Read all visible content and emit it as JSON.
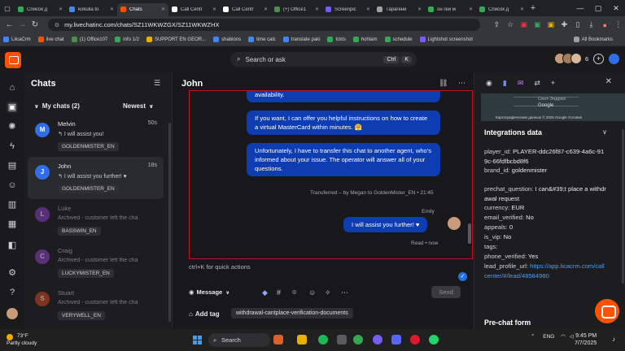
{
  "browser": {
    "tabs": [
      {
        "title": "Список д",
        "active": false,
        "color": "#34a853"
      },
      {
        "title": "kokulla to",
        "active": false,
        "color": "#4285f4"
      },
      {
        "title": "Chats",
        "active": true,
        "color": "#ff5100"
      },
      {
        "title": "Call Centr",
        "active": false,
        "color": "#ffffff"
      },
      {
        "title": "Call Centr",
        "active": false,
        "color": "#ffffff"
      },
      {
        "title": "(+) Office1",
        "active": false,
        "color": "#4a8f4a"
      },
      {
        "title": "Screenpic",
        "active": false,
        "color": "#7a5af8"
      },
      {
        "title": "Тарагени",
        "active": false,
        "color": "#a0a0a0"
      },
      {
        "title": "он гей м",
        "active": false,
        "color": "#34a853"
      },
      {
        "title": "Список д",
        "active": false,
        "color": "#34a853"
      }
    ],
    "new_tab": "+",
    "url": "my.livechatinc.com/chats/SZ11WKWZGX/SZ11WKWZHX",
    "bookmarks": [
      {
        "label": "LiicaCrm",
        "color": "#4285f4"
      },
      {
        "label": "live chat",
        "color": "#ff5100"
      },
      {
        "label": "(1) Office107",
        "color": "#4a8f4a"
      },
      {
        "label": "info 1/2",
        "color": "#34a853"
      },
      {
        "label": "SUPPORT EN GEOR...",
        "color": "#e8b100"
      },
      {
        "label": "shablons",
        "color": "#4285f4"
      },
      {
        "label": "time calc",
        "color": "#4285f4"
      },
      {
        "label": "translate paki",
        "color": "#4285f4"
      },
      {
        "label": "tckts",
        "color": "#34a853"
      },
      {
        "label": "hohlam",
        "color": "#34a853"
      },
      {
        "label": "schedule",
        "color": "#34a853"
      },
      {
        "label": "Lightshot screenshot",
        "color": "#7a5af8"
      }
    ],
    "all_bookmarks": "All Bookmarks"
  },
  "topbar": {
    "search_label": "Search or ask",
    "kbd_ctrl": "Ctrl",
    "kbd_k": "K",
    "agent_count": "6"
  },
  "chatlist": {
    "title": "Chats",
    "section": "My chats (2)",
    "sort": "Newest",
    "items": [
      {
        "initial": "M",
        "name": "Melvin",
        "time": "50s",
        "message": "I will assist you!",
        "tag": "GOLDENMISTER_EN",
        "avatar_color": "#2f6ee8",
        "active": false,
        "dim": false
      },
      {
        "initial": "J",
        "name": "John",
        "time": "18s",
        "message": "I will assist you further! ♥",
        "tag": "GOLDENMISTER_EN",
        "avatar_color": "#2f6ee8",
        "active": true,
        "dim": false
      },
      {
        "initial": "L",
        "name": "Luke",
        "time": "",
        "message": "Archived - customer left the cha",
        "tag": "BASSWIN_EN",
        "avatar_color": "#8a3fc4",
        "active": false,
        "dim": true
      },
      {
        "initial": "C",
        "name": "Craig",
        "time": "",
        "message": "Archived - customer left the cha",
        "tag": "LUCKYMISTER_EN",
        "avatar_color": "#8a3fc4",
        "active": false,
        "dim": true
      },
      {
        "initial": "S",
        "name": "Stuart",
        "time": "",
        "message": "Archived - customer left the cha",
        "tag": "VERYWELL_EN",
        "avatar_color": "#d1461e",
        "active": false,
        "dim": true
      }
    ]
  },
  "chat": {
    "title": "John",
    "messages": [
      {
        "text": "availability."
      },
      {
        "text": "If you want, I can offer you helpful instructions on how to create a virtual MasterCard within minutes. 🤗"
      },
      {
        "text": "Unfortunately, I have to transfer this chat to another agent, who's informed about your issue. The operator will answer all of your questions."
      }
    ],
    "transfer_note": "Transferred – by Megan to GoldenMister_EN • 21:45",
    "agent_name": "Emily",
    "agent_message": "I will assist you further! ♥",
    "read_status": "Read • now",
    "composer_placeholder": "ctrl+K for quick actions",
    "mode": "Message",
    "send_label": "Send",
    "add_tag_label": "Add tag",
    "tag": "withdrawal-cantplace-verification-documents"
  },
  "rightpanel": {
    "map_place": "Сент-Эндрюс",
    "map_logo": "Google",
    "map_caption": "Картографические данные © 2025 Google    Условия",
    "integrations_title": "Integrations data",
    "fields": [
      {
        "key": "player_id:",
        "value": "PLAYER-ddc26f87-c639-4a6c-919c-66fdfbcbd8f6",
        "link": false
      },
      {
        "key": "brand_id:",
        "value": "goldenmister",
        "link": false
      },
      {
        "key": "prechat_question:",
        "value": "I can&#39;t place a withdrawal request",
        "link": false
      },
      {
        "key": "currency:",
        "value": "EUR",
        "link": false
      },
      {
        "key": "email_verified:",
        "value": "No",
        "link": false
      },
      {
        "key": "appeals:",
        "value": "0",
        "link": false
      },
      {
        "key": "is_vip:",
        "value": "No",
        "link": false
      },
      {
        "key": "tags:",
        "value": "",
        "link": false
      },
      {
        "key": "phone_verified:",
        "value": "Yes",
        "link": false
      },
      {
        "key": "lead_profile_url:",
        "value": "https://app.licacrm.com/callcenter/#/lead/48584980",
        "link": true
      }
    ],
    "prechat_title": "Pre-chat form"
  },
  "taskbar": {
    "temperature": "73°F",
    "weather": "Partly cloudy",
    "search": "Search",
    "lang": "ENG",
    "time": "9:45 PM",
    "date": "7/7/2025"
  }
}
